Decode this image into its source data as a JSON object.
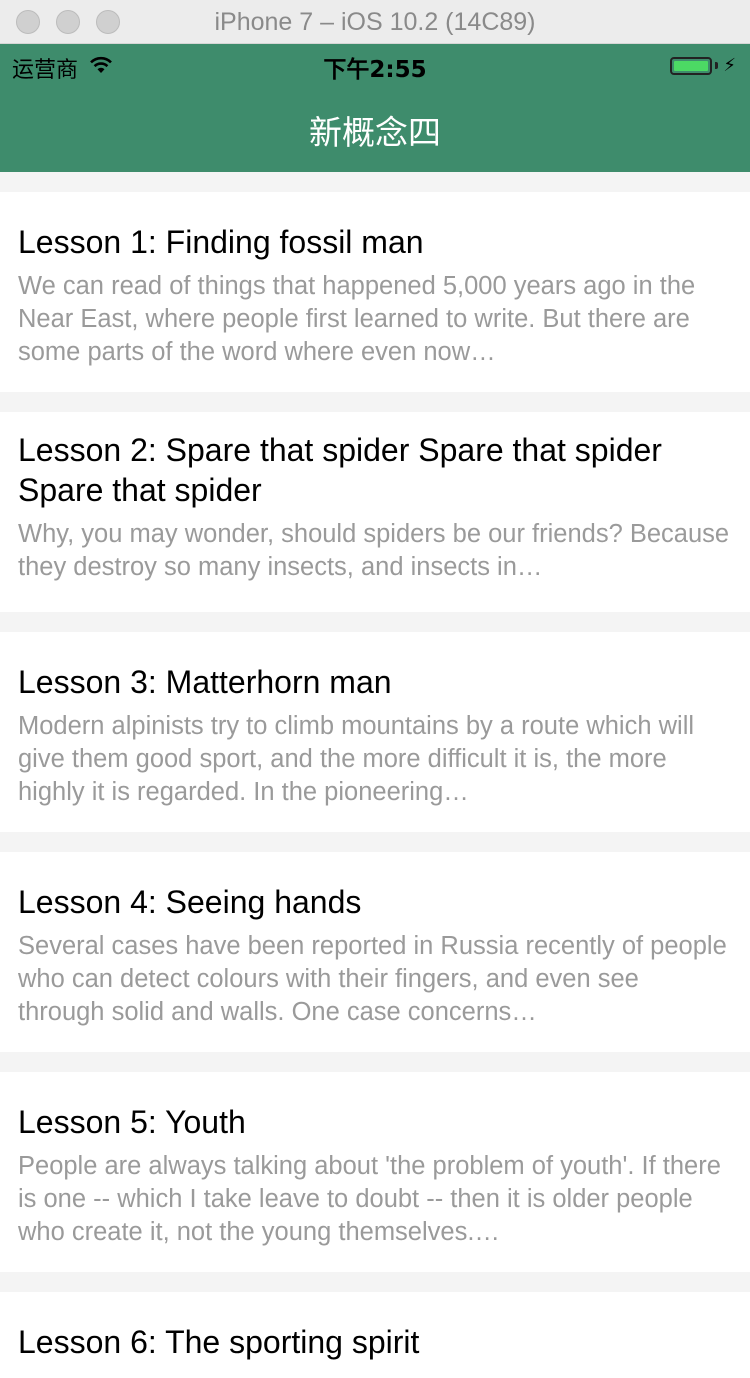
{
  "window": {
    "title": "iPhone 7 – iOS 10.2 (14C89)"
  },
  "status_bar": {
    "carrier": "运营商",
    "time": "下午2:55"
  },
  "nav": {
    "title": "新概念四"
  },
  "lessons": [
    {
      "title": "Lesson 1: Finding fossil man",
      "summary": "We can read of things that happened 5,000 years ago in the Near East, where people first learned to write. But there are some parts of the word where even now…"
    },
    {
      "title": "Lesson 2: Spare that spider Spare that spider Spare that spider",
      "summary": "Why, you may wonder, should spiders be our friends? Because they destroy so many insects, and insects in…"
    },
    {
      "title": "Lesson 3: Matterhorn man",
      "summary": "Modern alpinists try to climb mountains by a route which will give them good sport, and the more difficult it is, the more highly it is regarded. In the pioneering…"
    },
    {
      "title": "Lesson 4: Seeing hands",
      "summary": "Several cases have been reported in Russia recently of people who can detect colours with their fingers, and even see through solid and walls. One case concerns…"
    },
    {
      "title": "Lesson 5: Youth",
      "summary": "People are always talking about 'the problem of youth'. If there is one -- which I take leave to doubt -- then it is older people who create it, not the young themselves.…"
    },
    {
      "title": "Lesson 6: The sporting spirit",
      "summary": ""
    }
  ]
}
